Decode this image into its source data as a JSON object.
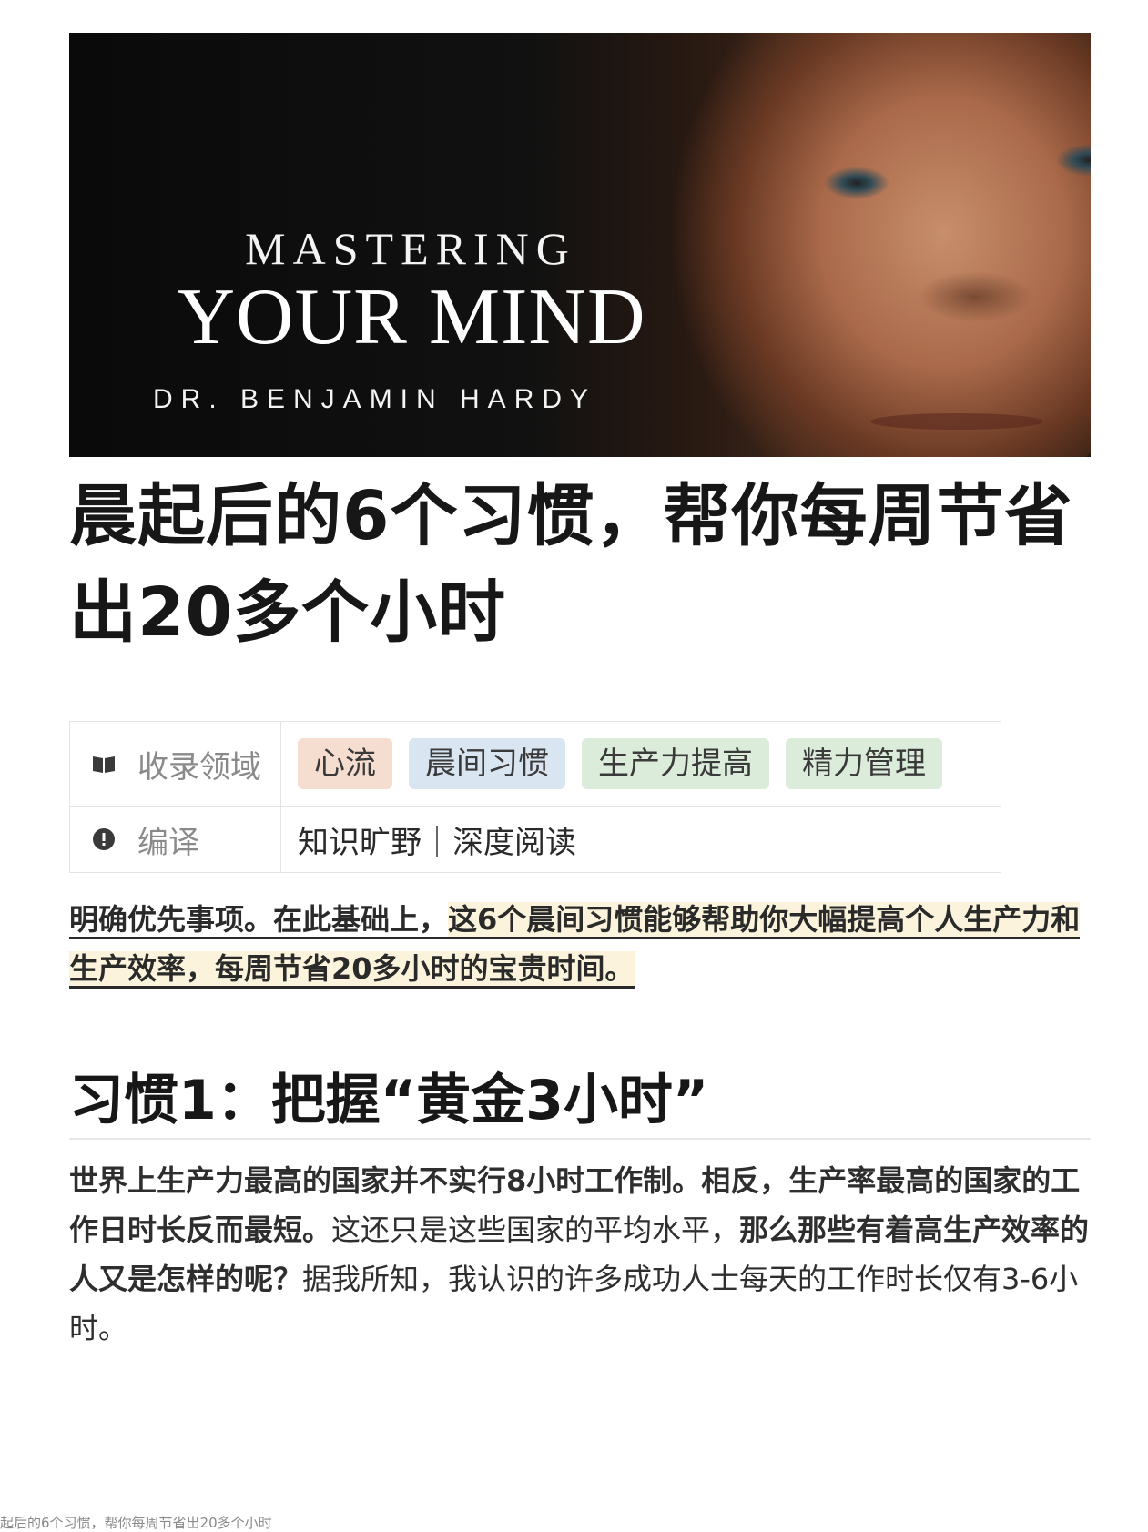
{
  "cover": {
    "line1": "MASTERING",
    "line2": "YOUR MIND",
    "line3": "DR. BENJAMIN HARDY"
  },
  "article": {
    "title": "晨起后的6个习惯，帮你每周节省出20多个小时"
  },
  "properties": {
    "domain_label": "收录领域",
    "domain_icon": "book-icon",
    "tags": [
      {
        "label": "心流",
        "color": "#f5ddd0"
      },
      {
        "label": "晨间习惯",
        "color": "#d9e6f1"
      },
      {
        "label": "生产力提高",
        "color": "#dcecda"
      },
      {
        "label": "精力管理",
        "color": "#dcecda"
      }
    ],
    "translate_label": "编译",
    "translate_icon": "info-icon",
    "translate_value": "知识旷野｜深度阅读"
  },
  "intro": {
    "plain": "明确优先事项。在此基础上，",
    "highlight": "这6个晨间习惯能够帮助你大幅提高个人生产力和生产效率，每周节省20多小时的宝贵时间。"
  },
  "section": {
    "heading": "习惯1：把握“黄金3小时”",
    "p_bold1": "世界上生产力最高的国家并不实行8小时工作制。相反，生产率最高的国家的工作日时长反而最短。",
    "p_normal1": "这还只是这些国家的平均水平，",
    "p_bold2": "那么那些有着高生产效率的人又是怎样的呢？",
    "p_normal2": "据我所知，我认识的许多成功人士每天的工作时长仅有3-6小时。"
  },
  "footer": {
    "caption": "起后的6个习惯，帮你每周节省出20多个小时"
  }
}
